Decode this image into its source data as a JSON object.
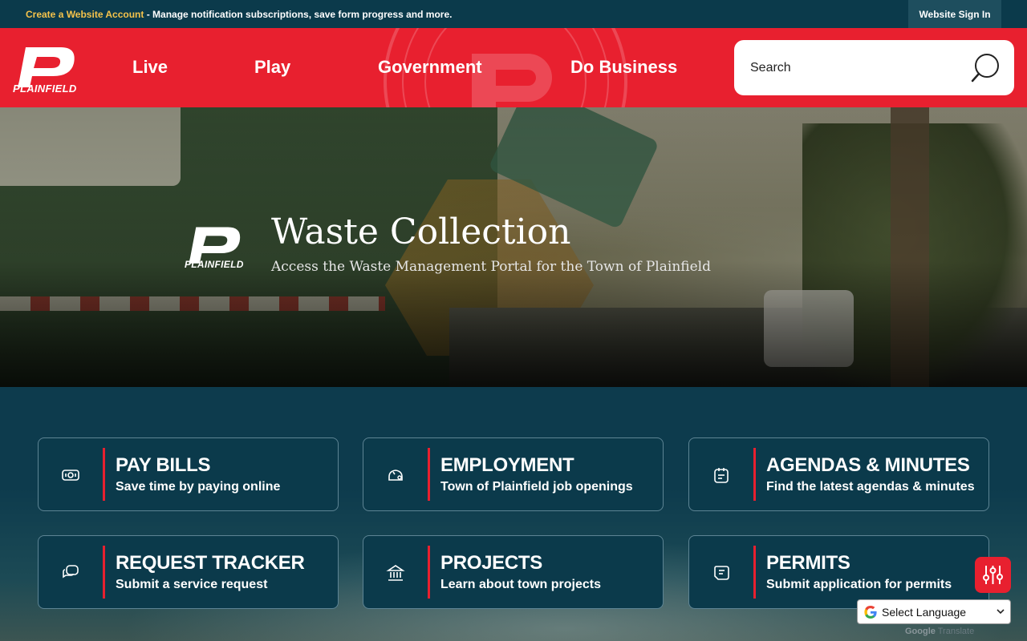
{
  "topbar": {
    "create_account_link": "Create a Website Account",
    "message": " - Manage notification subscriptions, save form progress and more.",
    "sign_in": "Website Sign In"
  },
  "header": {
    "logo_text": "PLAINFIELD",
    "nav": [
      "Live",
      "Play",
      "Government",
      "Do Business"
    ],
    "search_placeholder": "Search"
  },
  "hero": {
    "logo_text": "PLAINFIELD",
    "title": "Waste Collection",
    "subtitle": "Access the Waste Management Portal for the Town of Plainfield"
  },
  "cards": [
    {
      "title": "PAY BILLS",
      "subtitle": "Save time by paying online",
      "icon": "bill-icon"
    },
    {
      "title": "EMPLOYMENT",
      "subtitle": "Town of Plainfield job openings",
      "icon": "employment-icon"
    },
    {
      "title": "AGENDAS & MINUTES",
      "subtitle": "Find the latest agendas & minutes",
      "icon": "calendar-icon"
    },
    {
      "title": "REQUEST TRACKER",
      "subtitle": "Submit a service request",
      "icon": "chat-icon"
    },
    {
      "title": "PROJECTS",
      "subtitle": "Learn about town projects",
      "icon": "building-icon"
    },
    {
      "title": "PERMITS",
      "subtitle": "Submit application for permits",
      "icon": "permit-icon"
    }
  ],
  "translate": {
    "label": "Select Language",
    "powered_by_prefix": "Google",
    "powered_by_suffix": " Translate"
  },
  "colors": {
    "brand_red": "#e8202f",
    "navy": "#0b3a4b",
    "link_yellow": "#f5c34b"
  }
}
